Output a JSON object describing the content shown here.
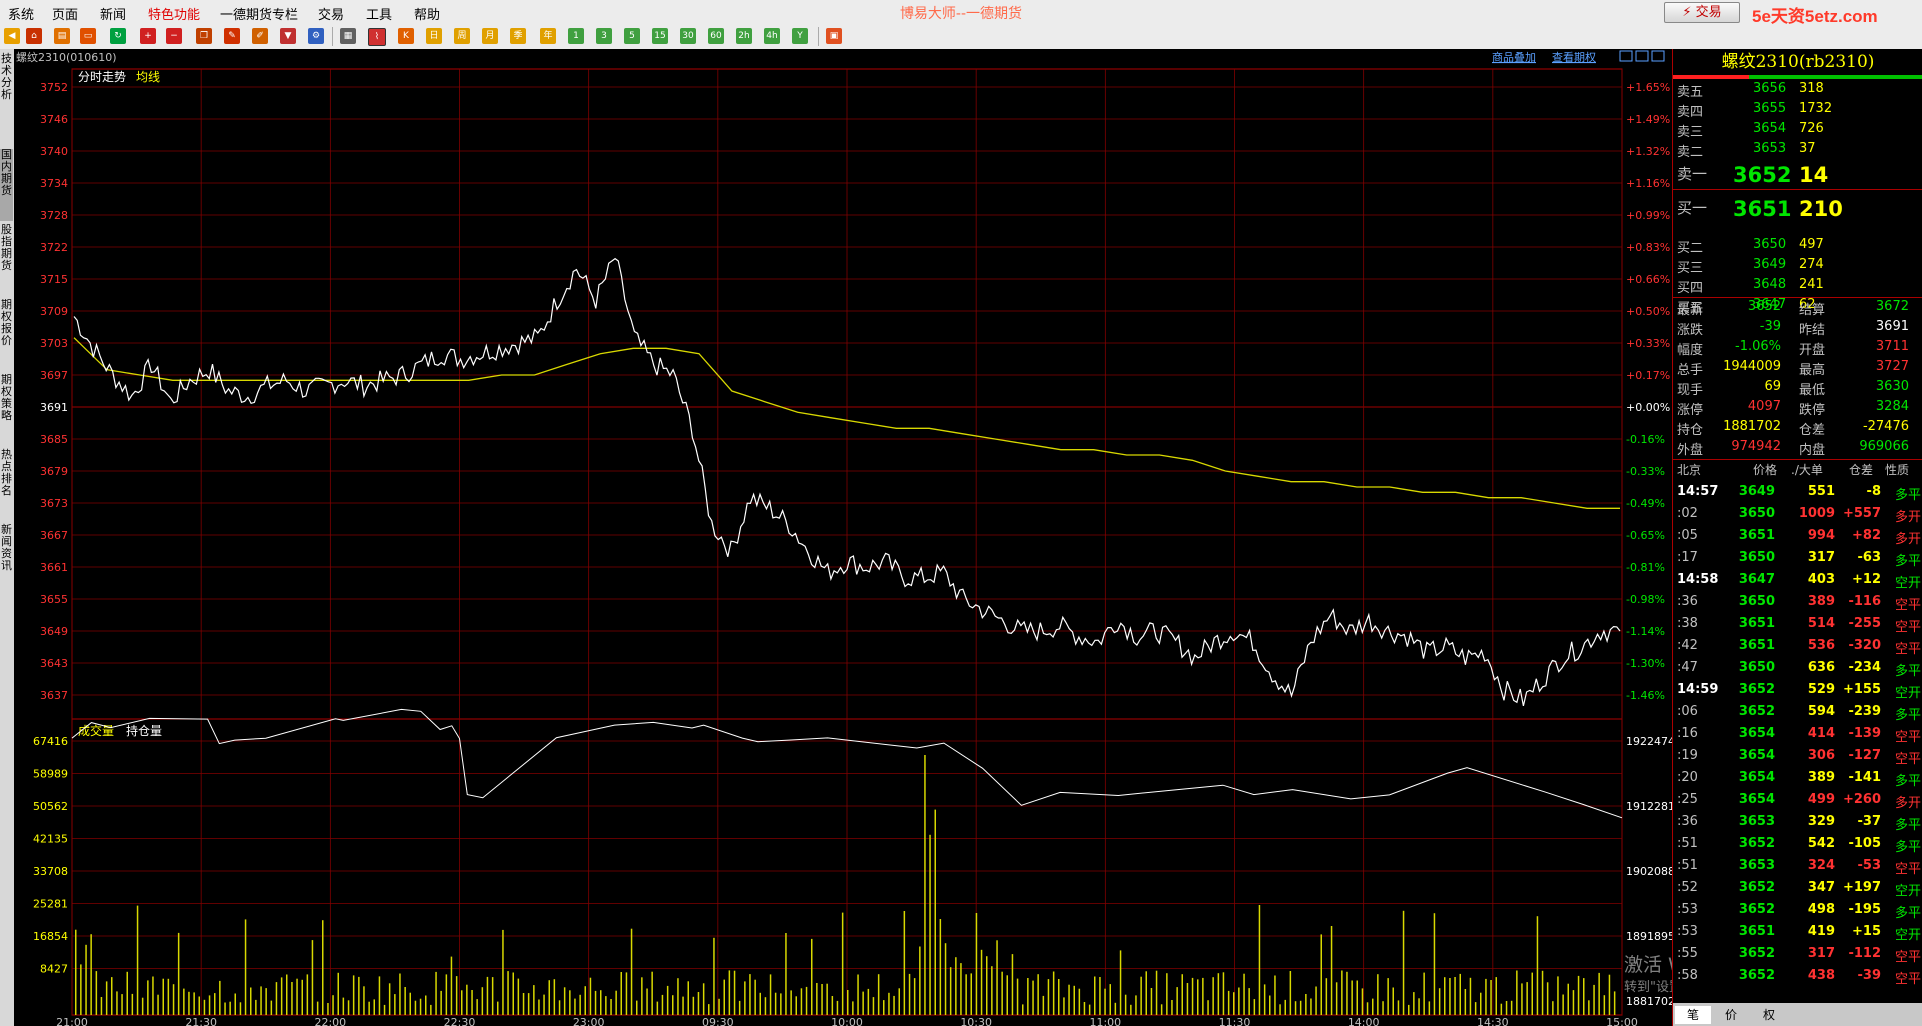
{
  "menu": [
    "系统",
    "页面",
    "新闻",
    "特色功能",
    "一德期货专栏",
    "交易",
    "工具",
    "帮助"
  ],
  "menu_highlight_index": 3,
  "app_title": "博易大师--一德期货",
  "trade_button": "交易",
  "watermark_top": "5e天资5etz.com",
  "left_rail_tabs": [
    "技术分析",
    "国内期货",
    "股指期货",
    "期权报价",
    "期权策略",
    "热点排名",
    "新闻资讯"
  ],
  "chart": {
    "instrument_label": "螺纹2310(010610)",
    "links": [
      "商品叠加",
      "查看期权"
    ],
    "price_legend": [
      "分时走势",
      "均线"
    ],
    "volume_legend": [
      "成交量",
      "持仓量"
    ],
    "price_ticks": [
      "3752",
      "3746",
      "3740",
      "3734",
      "3728",
      "3722",
      "3715",
      "3709",
      "3703",
      "3697",
      "3691",
      "3685",
      "3679",
      "3673",
      "3667",
      "3661",
      "3655",
      "3649",
      "3643",
      "3637"
    ],
    "pct_ticks": [
      "+1.65%",
      "+1.49%",
      "+1.32%",
      "+1.16%",
      "+0.99%",
      "+0.83%",
      "+0.66%",
      "+0.50%",
      "+0.33%",
      "+0.17%",
      "+0.00%",
      "-0.16%",
      "-0.33%",
      "-0.49%",
      "-0.65%",
      "-0.81%",
      "-0.98%",
      "-1.14%",
      "-1.30%",
      "-1.46%"
    ],
    "volume_ticks": [
      "67416",
      "58989",
      "50562",
      "42135",
      "33708",
      "25281",
      "16854",
      "8427"
    ],
    "oi_ticks": [
      "1922474",
      "1912281",
      "1902088",
      "1891895",
      "1881702"
    ],
    "time_ticks": [
      "21:00",
      "21:30",
      "22:00",
      "22:30",
      "23:00",
      "09:30",
      "10:00",
      "10:30",
      "11:00",
      "11:30",
      "14:00",
      "14:30",
      "15:00"
    ],
    "prev_settle": 3691
  },
  "chart_data": {
    "type": "line",
    "title": "螺纹2310 分时走势",
    "series": [
      {
        "name": "分时走势",
        "values": [
          3709,
          3703,
          3698,
          3694,
          3700,
          3693,
          3697,
          3699,
          3695,
          3694,
          3696,
          3697,
          3695,
          3696,
          3697,
          3696,
          3697,
          3698,
          3700,
          3702,
          3701,
          3702,
          3703,
          3704,
          3705,
          3712,
          3718,
          3712,
          3720,
          3705,
          3700,
          3698,
          3688,
          3670,
          3665,
          3675,
          3673,
          3670,
          3665,
          3661,
          3663,
          3662,
          3663,
          3660,
          3660,
          3661,
          3656,
          3654,
          3652,
          3650,
          3650,
          3651,
          3649,
          3648,
          3652,
          3649,
          3650,
          3648,
          3645,
          3648,
          3650,
          3648,
          3642,
          3638,
          3648,
          3653,
          3650,
          3652,
          3650,
          3649,
          3646,
          3647,
          3645,
          3646,
          3639,
          3637,
          3641,
          3645,
          3647,
          3650,
          3650
        ]
      },
      {
        "name": "均线",
        "values": [
          3705,
          3699,
          3698,
          3697,
          3697,
          3697,
          3697,
          3697,
          3697,
          3697,
          3697,
          3697,
          3697,
          3698,
          3698,
          3700,
          3702,
          3703,
          3703,
          3702,
          3695,
          3693,
          3691,
          3690,
          3689,
          3688,
          3688,
          3687,
          3686,
          3685,
          3684,
          3684,
          3683,
          3683,
          3682,
          3680,
          3679,
          3678,
          3678,
          3677,
          3677,
          3676,
          3676,
          3675,
          3675,
          3674,
          3673,
          3673
        ]
      }
    ],
    "volume_peak": 67416,
    "ylim": [
      3634,
      3755
    ]
  },
  "quote": {
    "title": "螺纹2310(rb2310)",
    "asks": [
      {
        "label": "卖五",
        "price": "3656",
        "vol": "318"
      },
      {
        "label": "卖四",
        "price": "3655",
        "vol": "1732"
      },
      {
        "label": "卖三",
        "price": "3654",
        "vol": "726"
      },
      {
        "label": "卖二",
        "price": "3653",
        "vol": "37"
      },
      {
        "label": "卖一",
        "price": "3652",
        "vol": "14"
      }
    ],
    "bids": [
      {
        "label": "买一",
        "price": "3651",
        "vol": "210"
      },
      {
        "label": "买二",
        "price": "3650",
        "vol": "497"
      },
      {
        "label": "买三",
        "price": "3649",
        "vol": "274"
      },
      {
        "label": "买四",
        "price": "3648",
        "vol": "241"
      },
      {
        "label": "买五",
        "price": "3647",
        "vol": "62"
      }
    ],
    "stats": [
      [
        "最新",
        "3652",
        "dn",
        "结算",
        "3672",
        "dn"
      ],
      [
        "涨跌",
        "-39",
        "dn",
        "昨结",
        "3691",
        "wh"
      ],
      [
        "幅度",
        "-1.06%",
        "dn",
        "开盘",
        "3711",
        "up"
      ],
      [
        "总手",
        "1944009",
        "yl",
        "最高",
        "3727",
        "up"
      ],
      [
        "现手",
        "69",
        "yl",
        "最低",
        "3630",
        "dn"
      ],
      [
        "涨停",
        "4097",
        "up",
        "跌停",
        "3284",
        "dn"
      ],
      [
        "持仓",
        "1881702",
        "yl",
        "仓差",
        "-27476",
        "yl"
      ],
      [
        "外盘",
        "974942",
        "up",
        "内盘",
        "969066",
        "dn"
      ]
    ],
    "ticks_header": [
      "北京",
      "价格",
      "./大单",
      "仓差",
      "性质"
    ],
    "ticks": [
      [
        "14:57",
        "3649",
        "551",
        "-8",
        "多平",
        "wh",
        "dn",
        "yl",
        "dn"
      ],
      [
        ":02",
        "3650",
        "1009",
        "+557",
        "多开",
        "gy",
        "dn",
        "up",
        "up"
      ],
      [
        ":05",
        "3651",
        "994",
        "+82",
        "多开",
        "gy",
        "dn",
        "up",
        "up"
      ],
      [
        ":17",
        "3650",
        "317",
        "-63",
        "多平",
        "gy",
        "dn",
        "yl",
        "dn"
      ],
      [
        "14:58",
        "3647",
        "403",
        "+12",
        "空开",
        "wh",
        "dn",
        "yl",
        "dn"
      ],
      [
        ":36",
        "3650",
        "389",
        "-116",
        "空平",
        "gy",
        "dn",
        "up",
        "up"
      ],
      [
        ":38",
        "3651",
        "514",
        "-255",
        "空平",
        "gy",
        "dn",
        "up",
        "up"
      ],
      [
        ":42",
        "3651",
        "536",
        "-320",
        "空平",
        "gy",
        "dn",
        "up",
        "up"
      ],
      [
        ":47",
        "3650",
        "636",
        "-234",
        "多平",
        "gy",
        "dn",
        "yl",
        "dn"
      ],
      [
        "14:59",
        "3652",
        "529",
        "+155",
        "空开",
        "wh",
        "dn",
        "yl",
        "dn"
      ],
      [
        ":06",
        "3652",
        "594",
        "-239",
        "多平",
        "gy",
        "dn",
        "yl",
        "dn"
      ],
      [
        ":16",
        "3654",
        "414",
        "-139",
        "空平",
        "gy",
        "dn",
        "up",
        "up"
      ],
      [
        ":19",
        "3654",
        "306",
        "-127",
        "空平",
        "gy",
        "dn",
        "up",
        "up"
      ],
      [
        ":20",
        "3654",
        "389",
        "-141",
        "多平",
        "gy",
        "dn",
        "yl",
        "dn"
      ],
      [
        ":25",
        "3654",
        "499",
        "+260",
        "多开",
        "gy",
        "dn",
        "up",
        "up"
      ],
      [
        ":36",
        "3653",
        "329",
        "-37",
        "多平",
        "gy",
        "dn",
        "yl",
        "dn"
      ],
      [
        ":51",
        "3652",
        "542",
        "-105",
        "多平",
        "gy",
        "dn",
        "yl",
        "dn"
      ],
      [
        ":51",
        "3653",
        "324",
        "-53",
        "空平",
        "gy",
        "dn",
        "up",
        "up"
      ],
      [
        ":52",
        "3652",
        "347",
        "+197",
        "空开",
        "gy",
        "dn",
        "yl",
        "dn"
      ],
      [
        ":53",
        "3652",
        "498",
        "-195",
        "多平",
        "gy",
        "dn",
        "yl",
        "dn"
      ],
      [
        ":53",
        "3651",
        "419",
        "+15",
        "空开",
        "gy",
        "dn",
        "yl",
        "dn"
      ],
      [
        ":55",
        "3652",
        "317",
        "-112",
        "空平",
        "gy",
        "dn",
        "up",
        "up"
      ],
      [
        ":58",
        "3652",
        "438",
        "-39",
        "空平",
        "gy",
        "dn",
        "up",
        "up"
      ]
    ],
    "bottom_tabs": [
      "笔",
      "价",
      "权"
    ]
  },
  "activate_windows": {
    "line1": "激活 Windows",
    "line2": "转到\"设置\"以激活 Windows。"
  }
}
